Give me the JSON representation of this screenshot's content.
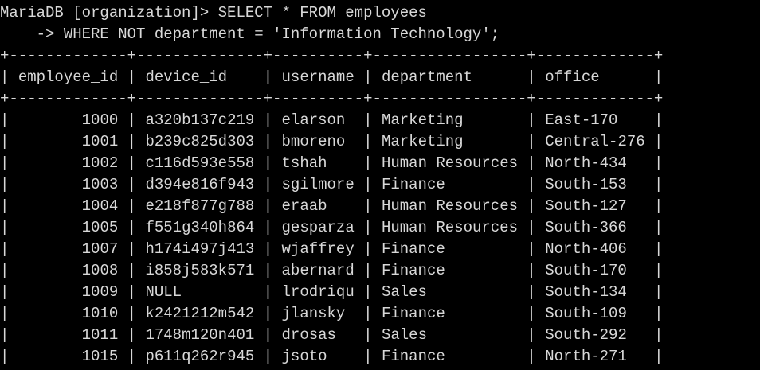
{
  "terminal": {
    "prompt": "MariaDB [organization]>",
    "query_line1": "SELECT * FROM employees",
    "continuation_prompt": "->",
    "query_line2": "WHERE NOT department = 'Information Technology';",
    "colors": {
      "background": "#000000",
      "text": "#d8d8d8"
    }
  },
  "result_table": {
    "columns": [
      "employee_id",
      "device_id",
      "username",
      "department",
      "office"
    ],
    "rows": [
      [
        "1000",
        "a320b137c219",
        "elarson",
        "Marketing",
        "East-170"
      ],
      [
        "1001",
        "b239c825d303",
        "bmoreno",
        "Marketing",
        "Central-276"
      ],
      [
        "1002",
        "c116d593e558",
        "tshah",
        "Human Resources",
        "North-434"
      ],
      [
        "1003",
        "d394e816f943",
        "sgilmore",
        "Finance",
        "South-153"
      ],
      [
        "1004",
        "e218f877g788",
        "eraab",
        "Human Resources",
        "South-127"
      ],
      [
        "1005",
        "f551g340h864",
        "gesparza",
        "Human Resources",
        "South-366"
      ],
      [
        "1007",
        "h174i497j413",
        "wjaffrey",
        "Finance",
        "North-406"
      ],
      [
        "1008",
        "i858j583k571",
        "abernard",
        "Finance",
        "South-170"
      ],
      [
        "1009",
        "NULL",
        "lrodriqu",
        "Sales",
        "South-134"
      ],
      [
        "1010",
        "k2421212m542",
        "jlansky",
        "Finance",
        "South-109"
      ],
      [
        "1011",
        "1748m120n401",
        "drosas",
        "Sales",
        "South-292"
      ],
      [
        "1015",
        "p611q262r945",
        "jsoto",
        "Finance",
        "North-271"
      ]
    ]
  }
}
